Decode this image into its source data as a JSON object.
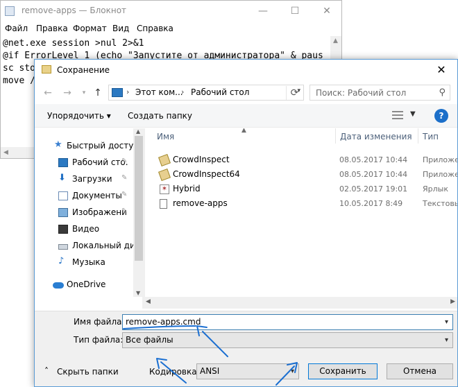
{
  "notepad": {
    "title": "remove-apps — Блокнот",
    "controls": {
      "minimize": "—",
      "maximize": "☐",
      "close": "✕"
    },
    "menu": [
      "Файл",
      "Правка",
      "Формат",
      "Вид",
      "Справка"
    ],
    "lines": [
      "@net.exe session >nul 2>&1",
      "@if ErrorLevel 1 (echo \"Запустите от администратора\" & paus",
      "",
      "sc sto",
      "move /"
    ]
  },
  "dialog": {
    "title": "Сохранение",
    "close": "✕",
    "nav": {
      "back": "←",
      "forward": "→",
      "up": "↑"
    },
    "address": {
      "segments": [
        "Этот ком...",
        "Рабочий стол"
      ],
      "separator": "›"
    },
    "search_placeholder": "Поиск: Рабочий стол",
    "toolbar": {
      "organize": "Упорядочить ▾",
      "new_folder": "Создать папку",
      "help": "?"
    },
    "sidebar": [
      {
        "label": "Быстрый доступ",
        "icon": "star-icon"
      },
      {
        "label": "Рабочий сто.",
        "icon": "desktop-icon",
        "pinned": true
      },
      {
        "label": "Загрузки",
        "icon": "download-icon",
        "pinned": true
      },
      {
        "label": "Документы",
        "icon": "documents-icon",
        "pinned": true
      },
      {
        "label": "Изображени",
        "icon": "pictures-icon",
        "pinned": true
      },
      {
        "label": "Видео",
        "icon": "video-icon"
      },
      {
        "label": "Локальный дис",
        "icon": "disk-icon"
      },
      {
        "label": "Музыка",
        "icon": "music-icon"
      },
      {
        "label": "OneDrive",
        "icon": "cloud-icon"
      }
    ],
    "columns": [
      "Имя",
      "Дата изменения",
      "Тип"
    ],
    "files": [
      {
        "name": "CrowdInspect",
        "date": "08.05.2017 10:44",
        "type": "Приложе"
      },
      {
        "name": "CrowdInspect64",
        "date": "08.05.2017 10:44",
        "type": "Приложе"
      },
      {
        "name": "Hybrid",
        "date": "02.05.2017 19:01",
        "type": "Ярлык"
      },
      {
        "name": "remove-apps",
        "date": "10.05.2017 8:49",
        "type": "Текстовы"
      }
    ],
    "filename_label": "Имя файла:",
    "filename_value": "remove-apps.cmd",
    "filetype_label": "Тип файла:",
    "filetype_value": "Все файлы",
    "hide_folders": "Скрыть папки",
    "encoding_label": "Кодировка:",
    "encoding_value": "ANSI",
    "save": "Сохранить",
    "cancel": "Отмена"
  },
  "colors": {
    "accent": "#0078d7",
    "annotation": "#1b6fd1"
  }
}
